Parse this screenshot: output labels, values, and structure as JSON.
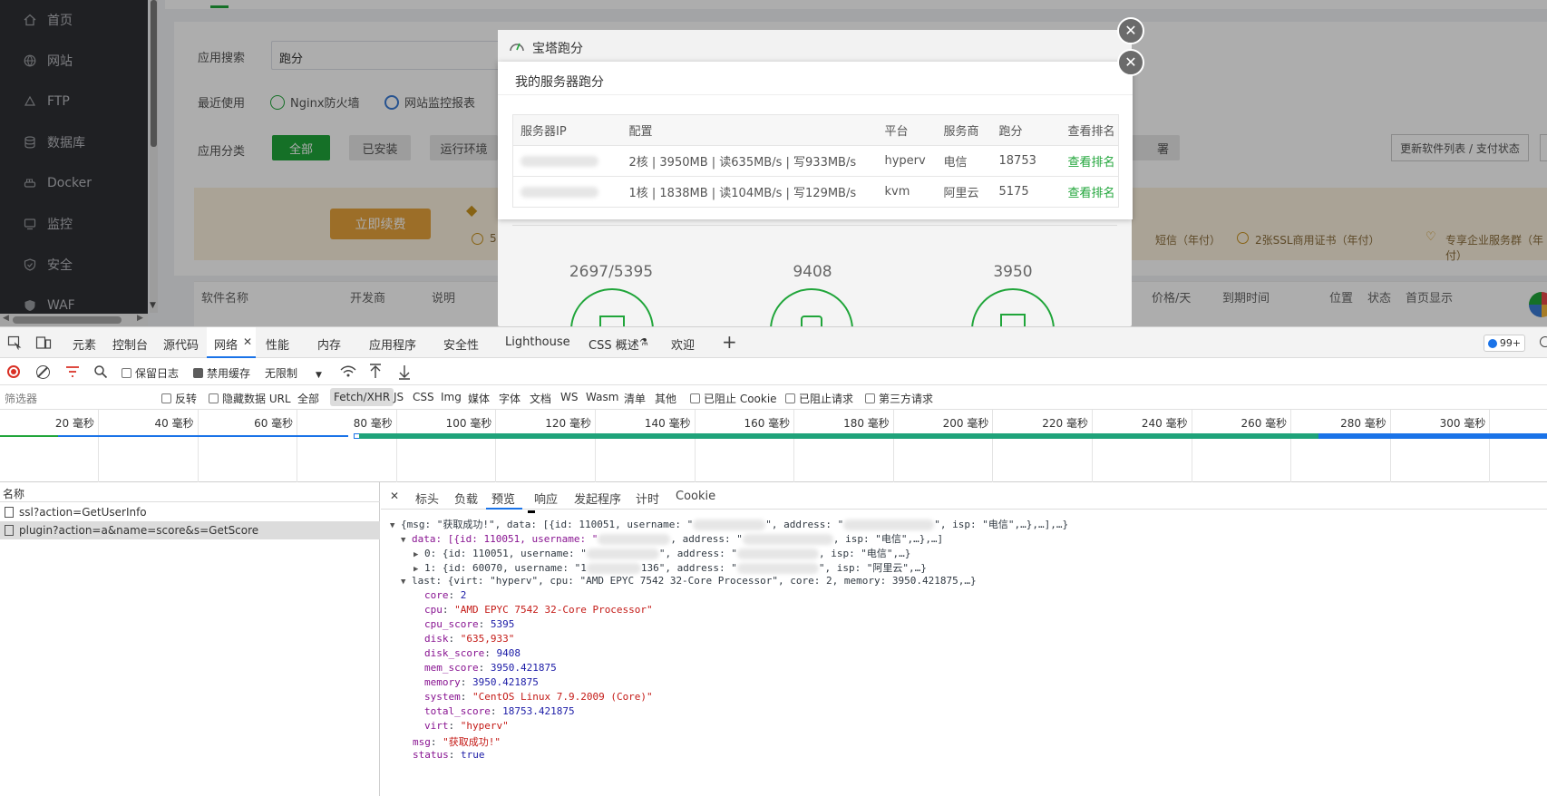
{
  "sidebar": {
    "items": [
      {
        "label": "首页",
        "icon": "home-icon"
      },
      {
        "label": "网站",
        "icon": "globe-icon"
      },
      {
        "label": "FTP",
        "icon": "ftp-icon"
      },
      {
        "label": "数据库",
        "icon": "database-icon"
      },
      {
        "label": "Docker",
        "icon": "docker-icon"
      },
      {
        "label": "监控",
        "icon": "monitor-icon"
      },
      {
        "label": "安全",
        "icon": "shield-icon"
      },
      {
        "label": "WAF",
        "icon": "waf-icon"
      }
    ]
  },
  "main": {
    "search_label": "应用搜索",
    "search_value": "跑分",
    "recent_label": "最近使用",
    "recent_items": [
      "Nginx防火墙",
      "网站监控报表"
    ],
    "category_label": "应用分类",
    "categories": [
      "全部",
      "已安装",
      "运行环境"
    ],
    "category_tail": "署",
    "update_button": "更新软件列表 / 支付状态",
    "renew_button": "立即续费",
    "promo_items": [
      "短信（年付）",
      "2张SSL商用证书（年付）",
      "专享企业服务群（年付）"
    ],
    "promo_prefix": "5",
    "table_headers": [
      "软件名称",
      "开发商",
      "说明",
      "价格/天",
      "到期时间",
      "位置",
      "状态",
      "首页显示"
    ]
  },
  "modal": {
    "back_title": "宝塔跑分",
    "title": "我的服务器跑分",
    "headers": [
      "服务器IP",
      "配置",
      "平台",
      "服务商",
      "跑分",
      "查看排名"
    ],
    "rows": [
      {
        "config": "2核 | 3950MB | 读635MB/s | 写933MB/s",
        "platform": "hyperv",
        "provider": "电信",
        "score": "18753",
        "link": "查看排名"
      },
      {
        "config": "1核 | 1838MB | 读104MB/s | 写129MB/s",
        "platform": "kvm",
        "provider": "阿里云",
        "score": "5175",
        "link": "查看排名"
      }
    ],
    "stats": [
      "2697/5395",
      "9408",
      "3950"
    ]
  },
  "devtools": {
    "tabs": [
      "元素",
      "控制台",
      "源代码",
      "网络",
      "性能",
      "内存",
      "应用程序",
      "安全性",
      "Lighthouse",
      "CSS 概述",
      "欢迎"
    ],
    "issues_badge": "99+",
    "toolbar": {
      "preserve_log": "保留日志",
      "disable_cache": "禁用缓存",
      "throttle": "无限制"
    },
    "filter": {
      "placeholder": "筛选器",
      "invert": "反转",
      "hide_data_urls": "隐藏数据 URL",
      "all": "全部",
      "types": [
        "Fetch/XHR",
        "JS",
        "CSS",
        "Img",
        "媒体",
        "字体",
        "文档",
        "WS",
        "Wasm",
        "清单",
        "其他"
      ],
      "blocked_cookies": "已阻止 Cookie",
      "blocked_requests": "已阻止请求",
      "third_party": "第三方请求"
    },
    "timeline_ticks": [
      "20 毫秒",
      "40 毫秒",
      "60 毫秒",
      "80 毫秒",
      "100 毫秒",
      "120 毫秒",
      "140 毫秒",
      "160 毫秒",
      "180 毫秒",
      "200 毫秒",
      "220 毫秒",
      "240 毫秒",
      "260 毫秒",
      "280 毫秒",
      "300 毫秒",
      "3"
    ],
    "requests_header": "名称",
    "requests": [
      "ssl?action=GetUserInfo",
      "plugin?action=a&name=score&s=GetScore"
    ],
    "preview_tabs": [
      "标头",
      "负载",
      "预览",
      "响应",
      "发起程序",
      "计时",
      "Cookie"
    ],
    "json": {
      "summary_pre": "{msg: \"获取成功!\", data: [{id: 110051, username: \"",
      "summary_post": "\", isp: \"电信\",…},…],…}",
      "data_pre": "data: [{id: 110051, username: \"",
      "data_mid": ", address: \"",
      "data_post": ", isp: \"电信\",…},…]",
      "item0_pre": "0: {id: 110051, username: \"",
      "item0_mid": "\", address: \"",
      "item0_post": ", isp: \"电信\",…}",
      "item1_pre": "1: {id: 60070, username: \"1",
      "item1_mid": "136\", address: \"",
      "item1_post": "\", isp: \"阿里云\",…}",
      "last_summary": "last: {virt: \"hyperv\", cpu: \"AMD EPYC 7542 32-Core Processor\", core: 2, memory: 3950.421875,…}",
      "fields": [
        {
          "key": "core",
          "value": "2",
          "type": "n"
        },
        {
          "key": "cpu",
          "value": "\"AMD EPYC 7542 32-Core Processor\"",
          "type": "s"
        },
        {
          "key": "cpu_score",
          "value": "5395",
          "type": "n"
        },
        {
          "key": "disk",
          "value": "\"635,933\"",
          "type": "s"
        },
        {
          "key": "disk_score",
          "value": "9408",
          "type": "n"
        },
        {
          "key": "mem_score",
          "value": "3950.421875",
          "type": "n"
        },
        {
          "key": "memory",
          "value": "3950.421875",
          "type": "n"
        },
        {
          "key": "system",
          "value": "\"CentOS Linux 7.9.2009 (Core)\"",
          "type": "s"
        },
        {
          "key": "total_score",
          "value": "18753.421875",
          "type": "n"
        },
        {
          "key": "virt",
          "value": "\"hyperv\"",
          "type": "s"
        }
      ],
      "msg_key": "msg",
      "msg_value": "\"获取成功!\"",
      "status_key": "status",
      "status_value": "true"
    }
  },
  "colors": {
    "sidebar": "#2f3034",
    "accent_green": "#20a53a",
    "renew_orange": "#e6a23c",
    "net_blue": "#1a73e8"
  }
}
